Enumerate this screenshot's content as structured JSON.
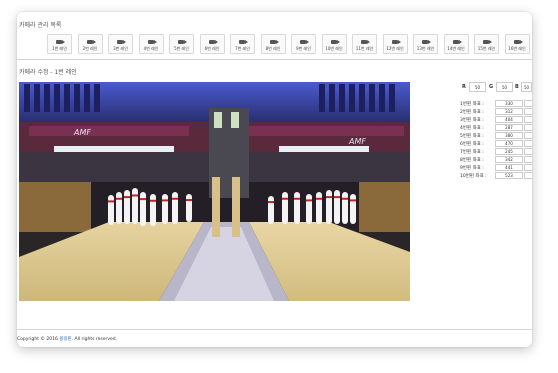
{
  "header": {
    "title": "카메라 관리 목록"
  },
  "cameras": [
    {
      "label": "1번 레인"
    },
    {
      "label": "2번 레인"
    },
    {
      "label": "3번 레인"
    },
    {
      "label": "4번 레인"
    },
    {
      "label": "5번 레인"
    },
    {
      "label": "6번 레인"
    },
    {
      "label": "7번 레인"
    },
    {
      "label": "8번 레인"
    },
    {
      "label": "9번 레인"
    },
    {
      "label": "10번 레인"
    },
    {
      "label": "11번 레인"
    },
    {
      "label": "12번 레인"
    },
    {
      "label": "13번 레인"
    },
    {
      "label": "14번 레인"
    },
    {
      "label": "15번 레인"
    },
    {
      "label": "16번 레인"
    }
  ],
  "edit": {
    "title": "카메라 수정 - 1번 레인",
    "scene_text": {
      "left_sign": "AMF",
      "right_sign": "AMF"
    }
  },
  "panel": {
    "r_label": "R",
    "r_value": "50",
    "g_label": "G",
    "g_value": "50",
    "b_label": "B",
    "b_value": "50",
    "rows": [
      {
        "label": "1번핀 좌표 :",
        "value": "330"
      },
      {
        "label": "2번핀 좌표 :",
        "value": "312"
      },
      {
        "label": "3번핀 좌표 :",
        "value": "404"
      },
      {
        "label": "4번핀 좌표 :",
        "value": "287"
      },
      {
        "label": "5번핀 좌표 :",
        "value": "380"
      },
      {
        "label": "6번핀 좌표 :",
        "value": "470"
      },
      {
        "label": "7번핀 좌표 :",
        "value": "245"
      },
      {
        "label": "8번핀 좌표 :",
        "value": "342"
      },
      {
        "label": "9번핀 좌표 :",
        "value": "441"
      },
      {
        "label": "10번핀 좌표 :",
        "value": "523"
      }
    ]
  },
  "footer": {
    "prefix": "Copyright © 2016 ",
    "brand": "볼링핀",
    "suffix": ". All rights reserved."
  },
  "colors": {
    "accent": "#2f6fb3",
    "lane": "#d9c48a",
    "pin": "#f4f4f4",
    "pin_stripe": "#c0242a",
    "divider": "#cfd6dc"
  }
}
